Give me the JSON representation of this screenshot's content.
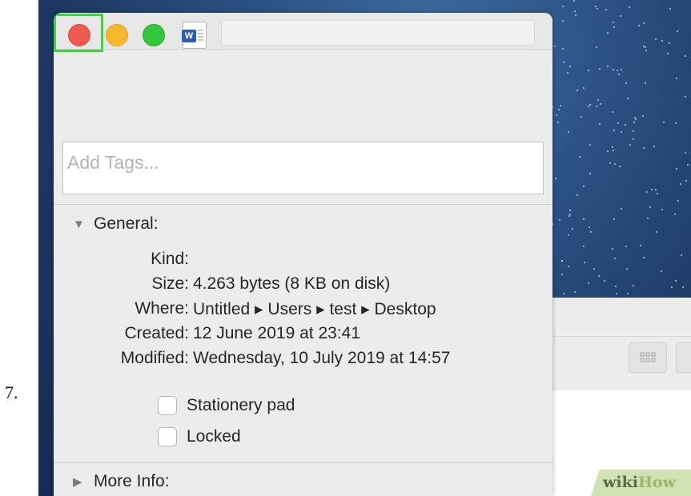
{
  "step_number": "7.",
  "window": {
    "traffic_lights": [
      "close-button",
      "minimize-button",
      "zoom-button"
    ],
    "file_icon": "word-document-icon",
    "file_icon_letter": "W"
  },
  "tags": {
    "placeholder": "Add Tags..."
  },
  "general": {
    "header": "General:",
    "rows": [
      {
        "label": "Kind:",
        "value": ""
      },
      {
        "label": "Size:",
        "value": "4.263 bytes (8 KB on disk)"
      },
      {
        "label": "Where:",
        "value": "Untitled ▸ Users ▸ test ▸ Desktop"
      },
      {
        "label": "Created:",
        "value": "12 June 2019 at 23:41"
      },
      {
        "label": "Modified:",
        "value": "Wednesday, 10 July 2019 at 14:57"
      }
    ],
    "checkboxes": [
      {
        "label": "Stationery pad",
        "checked": false
      },
      {
        "label": "Locked",
        "checked": false
      }
    ]
  },
  "more_info": {
    "header": "More Info:"
  },
  "watermark": {
    "wiki": "wiki",
    "how": "How"
  },
  "colors": {
    "close": "#ef5b52",
    "minimize": "#f5b82d",
    "zoom": "#34c63c",
    "highlight": "#3ed43e",
    "desktop": "#1c3660"
  }
}
